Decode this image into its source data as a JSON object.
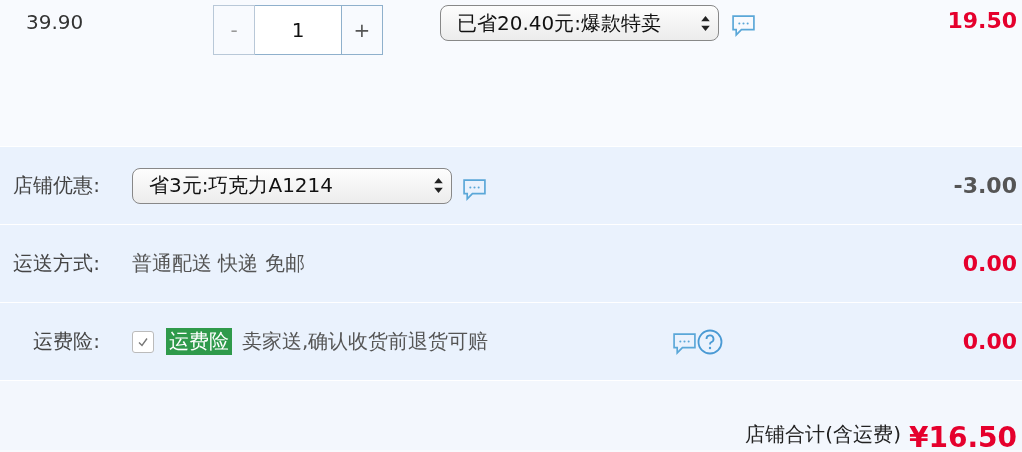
{
  "item": {
    "price": "39.90",
    "quantity": {
      "decrease": "-",
      "value": "1",
      "increase": "+"
    },
    "promotion": "已省20.40元:爆款特卖",
    "subtotal": "19.50"
  },
  "rows": [
    {
      "kind": "select",
      "label": "店铺优惠:",
      "value": "省3元:巧克力A1214",
      "amount": "-3.00",
      "highlight": false
    },
    {
      "kind": "text",
      "label": "运送方式:",
      "value": "普通配送 快递 免邮",
      "amount": "0.00",
      "highlight": true
    },
    {
      "kind": "checkbox",
      "label": "运费险:",
      "checked": true,
      "tag": "运费险",
      "value": "卖家送,确认收货前退货可赔",
      "amount": "0.00",
      "highlight": true
    }
  ],
  "total": {
    "label": "店铺合计(含运费)",
    "amount": "¥16.50"
  }
}
